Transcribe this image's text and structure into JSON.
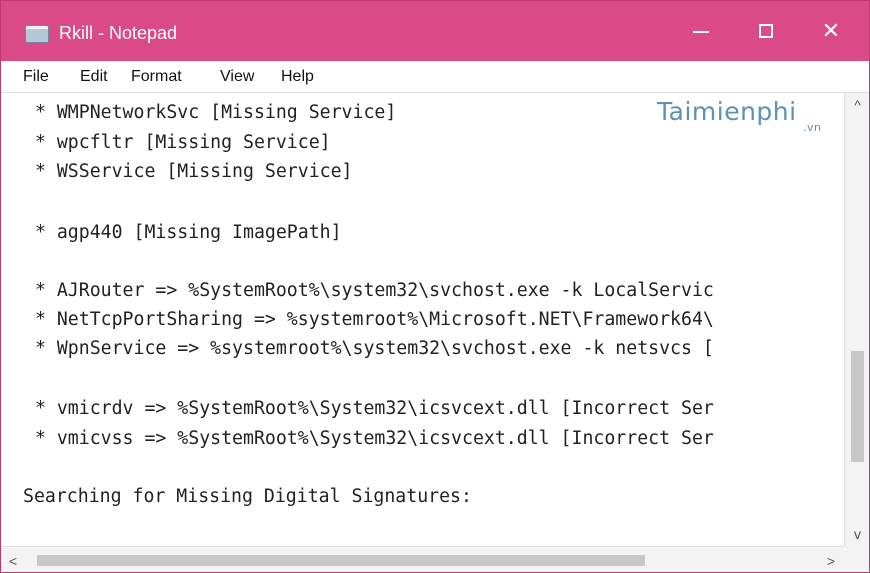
{
  "window": {
    "title": "Rkill - Notepad",
    "title_bar_color": "#d94a86"
  },
  "icons": {
    "app": "notepad-icon",
    "minimize": "minimize-icon",
    "maximize": "maximize-icon",
    "close": "close-icon",
    "scroll_up": "chevron-up-icon",
    "scroll_down": "chevron-down-icon",
    "scroll_left": "chevron-left-icon",
    "scroll_right": "chevron-right-icon"
  },
  "controls": {
    "close_label": "✕"
  },
  "menu": [
    {
      "label": "File"
    },
    {
      "label": "Edit"
    },
    {
      "label": "Format"
    },
    {
      "label": "View"
    },
    {
      "label": "Help"
    }
  ],
  "editor": {
    "lines": [
      " * WMPNetworkSvc [Missing Service]",
      " * wpcfltr [Missing Service]",
      " * WSService [Missing Service]",
      " * agp440 [Missing ImagePath]",
      " * AJRouter => %SystemRoot%\\system32\\svchost.exe -k LocalServic",
      " * NetTcpPortSharing => %systemroot%\\Microsoft.NET\\Framework64\\",
      " * WpnService => %systemroot%\\system32\\svchost.exe -k netsvcs [",
      " * vmicrdv => %SystemRoot%\\System32\\icsvcext.dll [Incorrect Ser",
      " * vmicvss => %SystemRoot%\\System32\\icsvcext.dll [Incorrect Ser",
      "Searching for Missing Digital Signatures:"
    ]
  },
  "watermark": {
    "main": "Taimienphi",
    "sub": ".vn"
  },
  "scrollbars": {
    "up": "^",
    "down": "v",
    "left": "<",
    "right": ">"
  }
}
